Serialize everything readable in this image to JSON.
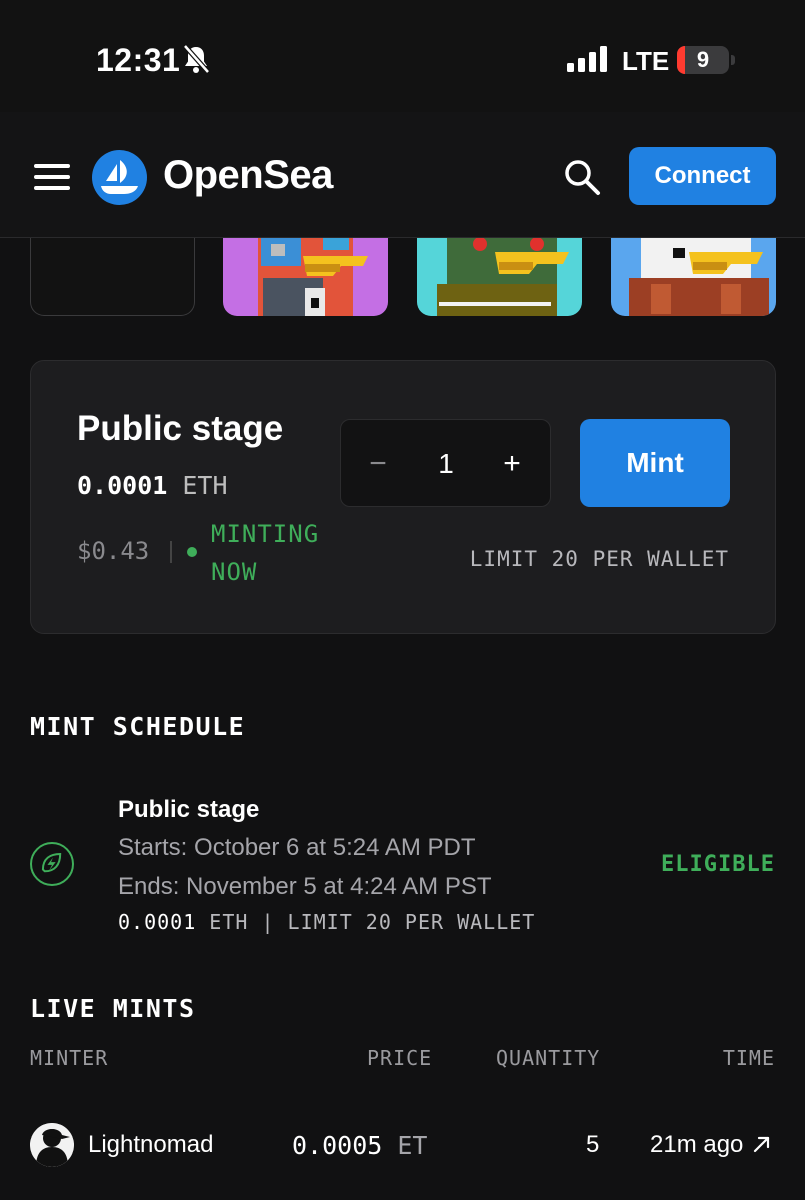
{
  "status_bar": {
    "time": "12:31",
    "network": "LTE",
    "battery_level": "9",
    "bell_icon": "bell-slash-icon",
    "signal_icon": "cellular-signal-icon"
  },
  "nav": {
    "brand": "OpenSea",
    "connect_label": "Connect",
    "menu_icon": "hamburger-menu-icon",
    "logo_icon": "opensea-sailboat-logo",
    "search_icon": "search-icon",
    "accent_color": "#2081e2"
  },
  "stage": {
    "title": "Public stage",
    "price_value": "0.0001",
    "price_currency": "ETH",
    "usd": "$0.43",
    "status": "MINTING NOW",
    "status_color": "#3fae5a",
    "quantity": "1",
    "minus_label": "−",
    "plus_label": "+",
    "mint_label": "Mint",
    "limit": "LIMIT 20 PER WALLET"
  },
  "schedule": {
    "heading": "MINT SCHEDULE",
    "title": "Public stage",
    "starts": "Starts: October 6 at 5:24 AM PDT",
    "ends": "Ends: November 5 at 4:24 AM PST",
    "price_value": "0.0001",
    "meta_rest": " ETH | LIMIT 20 PER WALLET",
    "eligibility": "ELIGIBLE",
    "icon": "lightning-leaf-icon"
  },
  "live_mints": {
    "heading": "LIVE MINTS",
    "columns": [
      "MINTER",
      "PRICE",
      "QUANTITY",
      "TIME"
    ],
    "rows": [
      {
        "minter": "Lightnomad",
        "price_value": "0.0005",
        "price_currency": "ET",
        "quantity": "5",
        "time": "21m ago",
        "link_icon": "arrow-up-right-icon"
      }
    ]
  }
}
